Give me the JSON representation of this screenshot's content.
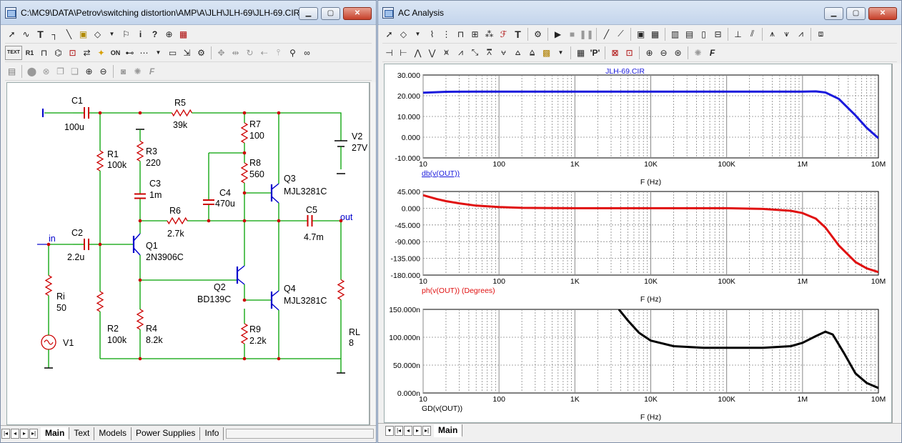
{
  "schematic_window": {
    "title": "C:\\MC9\\DATA\\Petrov\\switching distortion\\AMP\\A\\JLH\\JLH-69\\JLH-69.CIR",
    "toolbar1": [
      "select-arrow-icon",
      "wire-icon",
      "text-T-icon",
      "wire-step-icon",
      "diag-line-icon",
      "info-note-icon",
      "component-icon",
      "shape-icon",
      "flag-icon",
      "info-icon",
      "help-icon",
      "globe-icon",
      "probe-icon"
    ],
    "toolbar2_text": "TEXT",
    "tabs": [
      "Main",
      "Text",
      "Models",
      "Power Supplies",
      "Info"
    ],
    "components": [
      {
        "ref": "C1",
        "value": "100u"
      },
      {
        "ref": "R5",
        "value": "39k"
      },
      {
        "ref": "R7",
        "value": "100"
      },
      {
        "ref": "V2",
        "value": "27V"
      },
      {
        "ref": "R1",
        "value": "100k"
      },
      {
        "ref": "R3",
        "value": "220"
      },
      {
        "ref": "R8",
        "value": "560"
      },
      {
        "ref": "Q3",
        "value": "MJL3281C"
      },
      {
        "ref": "C3",
        "value": "1m"
      },
      {
        "ref": "C4",
        "value": "470u"
      },
      {
        "ref": "R6",
        "value": "2.7k"
      },
      {
        "ref": "C5",
        "value": "4.7m"
      },
      {
        "ref": "C2",
        "value": "2.2u"
      },
      {
        "ref": "Q1",
        "value": "2N3906C"
      },
      {
        "ref": "Q2",
        "value": "BD139C"
      },
      {
        "ref": "Q4",
        "value": "MJL3281C"
      },
      {
        "ref": "Ri",
        "value": "50"
      },
      {
        "ref": "V1",
        "value": ""
      },
      {
        "ref": "R2",
        "value": "100k"
      },
      {
        "ref": "R4",
        "value": "8.2k"
      },
      {
        "ref": "R9",
        "value": "2.2k"
      },
      {
        "ref": "RL",
        "value": "8"
      }
    ],
    "nodes": {
      "in": "in",
      "out": "out"
    }
  },
  "ac_window": {
    "title": "AC Analysis",
    "tabs": [
      "Main"
    ],
    "plots": [
      {
        "id": "gain",
        "title": "JLH-69.CIR",
        "ylabel": "db(v(OUT))",
        "xlabel": "F (Hz)",
        "yticks": [
          "30.000",
          "20.000",
          "10.000",
          "0.000",
          "-10.000"
        ],
        "ylim": [
          -10,
          30
        ],
        "color": "#1a1adc"
      },
      {
        "id": "phase",
        "ylabel": "ph(v(OUT)) (Degrees)",
        "xlabel": "F (Hz)",
        "yticks": [
          "45.000",
          "0.000",
          "-45.000",
          "-90.000",
          "-135.000",
          "-180.000"
        ],
        "ylim": [
          -180,
          45
        ],
        "color": "#e01010"
      },
      {
        "id": "gd",
        "ylabel": "GD(v(OUT))",
        "xlabel": "F (Hz)",
        "yticks": [
          "150.000n",
          "100.000n",
          "50.000n",
          "0.000n"
        ],
        "ylim": [
          0,
          150
        ],
        "color": "#000000"
      }
    ],
    "xticks": [
      "10",
      "100",
      "1K",
      "10K",
      "100K",
      "1M",
      "10M"
    ],
    "xlim": [
      10,
      10000000
    ]
  },
  "chart_data": [
    {
      "type": "line",
      "title": "JLH-69.CIR",
      "xlabel": "F (Hz)",
      "ylabel": "db(v(OUT))",
      "xscale": "log",
      "xlim": [
        10,
        10000000
      ],
      "ylim": [
        -10,
        30
      ],
      "grid": true,
      "series": [
        {
          "name": "db(v(OUT))",
          "color": "#1a1adc",
          "x": [
            10,
            20,
            50,
            100,
            1000,
            10000,
            100000,
            1000000,
            1500000,
            2000000,
            3000000,
            5000000,
            7000000,
            10000000
          ],
          "y": [
            21.5,
            21.9,
            22.0,
            22.0,
            22.0,
            22.0,
            22.0,
            22.0,
            22.1,
            21.6,
            18.5,
            10.5,
            4.5,
            -0.5
          ]
        }
      ]
    },
    {
      "type": "line",
      "xlabel": "F (Hz)",
      "ylabel": "ph(v(OUT)) (Degrees)",
      "xscale": "log",
      "xlim": [
        10,
        10000000
      ],
      "ylim": [
        -180,
        45
      ],
      "grid": true,
      "series": [
        {
          "name": "ph(v(OUT)) (Degrees)",
          "color": "#e01010",
          "x": [
            10,
            15,
            20,
            30,
            50,
            100,
            200,
            1000,
            10000,
            100000,
            300000,
            700000,
            1000000,
            1500000,
            2000000,
            3000000,
            5000000,
            7000000,
            10000000
          ],
          "y": [
            35,
            25,
            19,
            13,
            7,
            3,
            1,
            0,
            0,
            0,
            -2,
            -7,
            -13,
            -28,
            -52,
            -100,
            -145,
            -162,
            -172
          ]
        }
      ]
    },
    {
      "type": "line",
      "xlabel": "F (Hz)",
      "ylabel": "GD(v(OUT))",
      "xscale": "log",
      "xlim": [
        10,
        10000000
      ],
      "ylim": [
        0,
        150
      ],
      "grid": true,
      "series": [
        {
          "name": "GD(v(OUT))",
          "color": "#000000",
          "x": [
            3800,
            5000,
            7000,
            10000,
            20000,
            50000,
            100000,
            300000,
            700000,
            1000000,
            1500000,
            2000000,
            2500000,
            3500000,
            5000000,
            7000000,
            10000000
          ],
          "y": [
            150,
            130,
            108,
            94,
            84,
            81,
            81,
            81,
            84,
            90,
            102,
            110,
            105,
            72,
            35,
            18,
            9
          ]
        }
      ]
    }
  ]
}
